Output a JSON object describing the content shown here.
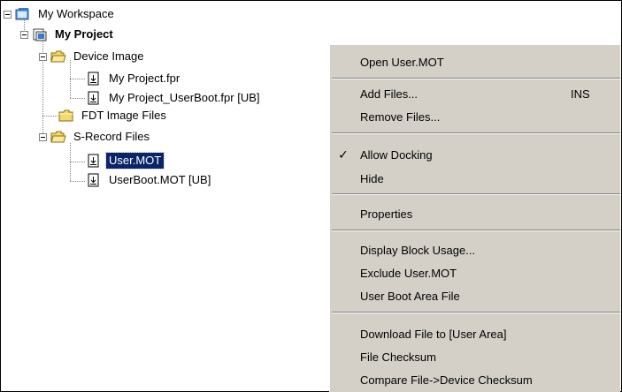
{
  "tree": {
    "workspace": {
      "label": "My Workspace"
    },
    "project": {
      "label": "My Project"
    },
    "device_image": {
      "label": "Device Image"
    },
    "file_fpr": {
      "label": "My Project.fpr"
    },
    "file_userboot_fpr": {
      "label": "My Project_UserBoot.fpr  [UB]"
    },
    "fdt_image_files": {
      "label": "FDT Image Files"
    },
    "srecord_files": {
      "label": "S-Record Files"
    },
    "user_mot": {
      "label": "User.MOT"
    },
    "userboot_mot": {
      "label": "UserBoot.MOT  [UB]"
    }
  },
  "context_menu": {
    "items": [
      {
        "label": "Open User.MOT"
      },
      {
        "label": "Add Files...",
        "shortcut": "INS"
      },
      {
        "label": "Remove Files..."
      },
      {
        "label": "Allow Docking",
        "checked": true,
        "check_mark": "✓"
      },
      {
        "label": "Hide"
      },
      {
        "label": "Properties"
      },
      {
        "label": "Display Block Usage..."
      },
      {
        "label": "Exclude User.MOT"
      },
      {
        "label": "User Boot Area File"
      },
      {
        "label": "Download File to [User Area]"
      },
      {
        "label": "File Checksum"
      },
      {
        "label": "Compare File->Device Checksum"
      }
    ]
  },
  "icons": {
    "workspace": "workspace-icon",
    "project": "project-icon",
    "folder": "folder-icon",
    "file": "download-file-icon",
    "expander": "collapse-minus-icon"
  },
  "colors": {
    "selection_bg": "#0a246a",
    "menu_bg": "#d4d0c8",
    "folder": "#f4d96b"
  }
}
